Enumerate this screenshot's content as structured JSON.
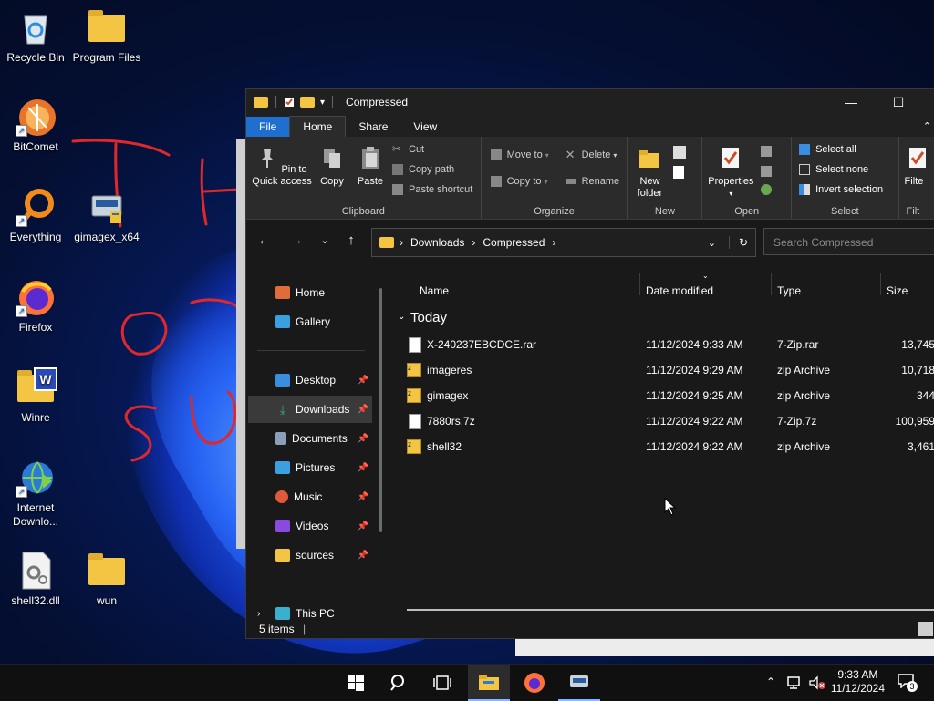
{
  "desktop": {
    "icons": [
      {
        "label": "Recycle Bin"
      },
      {
        "label": "Program Files"
      },
      {
        "label": "BitComet"
      },
      {
        "label": "Everything"
      },
      {
        "label": "gimagex_x64"
      },
      {
        "label": "Firefox"
      },
      {
        "label": "Winre"
      },
      {
        "label": "Internet Downlo..."
      },
      {
        "label": "shell32.dll"
      },
      {
        "label": "wun"
      }
    ],
    "annotation_strokes": "THIS OS"
  },
  "window": {
    "title": "Compressed",
    "controls": {
      "minimize": "—",
      "maximize": "☐",
      "close": "✕"
    },
    "tabs": [
      "File",
      "Home",
      "Share",
      "View"
    ],
    "ribbon": {
      "clipboard": {
        "name": "Clipboard",
        "pin_to_quick_access": "Pin to Quick access",
        "copy": "Copy",
        "paste": "Paste",
        "cut": "Cut",
        "copy_path": "Copy path",
        "paste_shortcut": "Paste shortcut"
      },
      "organize": {
        "name": "Organize",
        "move_to": "Move to",
        "copy_to": "Copy to",
        "delete": "Delete",
        "rename": "Rename"
      },
      "new": {
        "name": "New",
        "new_folder": "New folder"
      },
      "open": {
        "name": "Open",
        "properties": "Properties"
      },
      "select": {
        "name": "Select",
        "select_all": "Select all",
        "select_none": "Select none",
        "invert_selection": "Invert selection"
      },
      "filter": {
        "name": "Filt",
        "label": "Filte"
      }
    },
    "address": {
      "crumbs": [
        "Downloads",
        "Compressed"
      ],
      "search_placeholder": "Search Compressed"
    },
    "nav": [
      {
        "label": "Home",
        "color": "#e06c3a",
        "pinned": false
      },
      {
        "label": "Gallery",
        "color": "#3aa0e0",
        "pinned": false
      },
      {
        "label": "Desktop",
        "color": "#3a8ee0",
        "pinned": true
      },
      {
        "label": "Downloads",
        "color": "#2fb36b",
        "pinned": true,
        "selected": true
      },
      {
        "label": "Documents",
        "color": "#8aa0b8",
        "pinned": true
      },
      {
        "label": "Pictures",
        "color": "#3aa0e0",
        "pinned": true
      },
      {
        "label": "Music",
        "color": "#e05a3a",
        "pinned": true
      },
      {
        "label": "Videos",
        "color": "#8a4ae0",
        "pinned": true
      },
      {
        "label": "sources",
        "color": "#f4c542",
        "pinned": true
      },
      {
        "label": "This PC",
        "color": "#3ab0d0",
        "pinned": false
      }
    ],
    "columns": [
      "Name",
      "Date modified",
      "Type",
      "Size"
    ],
    "group": "Today",
    "files": [
      {
        "name": "X-240237EBCDCE.rar",
        "date": "11/12/2024 9:33 AM",
        "type": "7-Zip.rar",
        "size": "13,745",
        "icon": "file"
      },
      {
        "name": "imageres",
        "date": "11/12/2024 9:29 AM",
        "type": "zip Archive",
        "size": "10,718",
        "icon": "zip"
      },
      {
        "name": "gimagex",
        "date": "11/12/2024 9:25 AM",
        "type": "zip Archive",
        "size": "344",
        "icon": "zip"
      },
      {
        "name": "7880rs.7z",
        "date": "11/12/2024 9:22 AM",
        "type": "7-Zip.7z",
        "size": "100,959",
        "icon": "file"
      },
      {
        "name": "shell32",
        "date": "11/12/2024 9:22 AM",
        "type": "zip Archive",
        "size": "3,461",
        "icon": "zip"
      }
    ],
    "status": "5 items"
  },
  "taskbar": {
    "time": "9:33 AM",
    "date": "11/12/2024",
    "notifications": "3"
  }
}
